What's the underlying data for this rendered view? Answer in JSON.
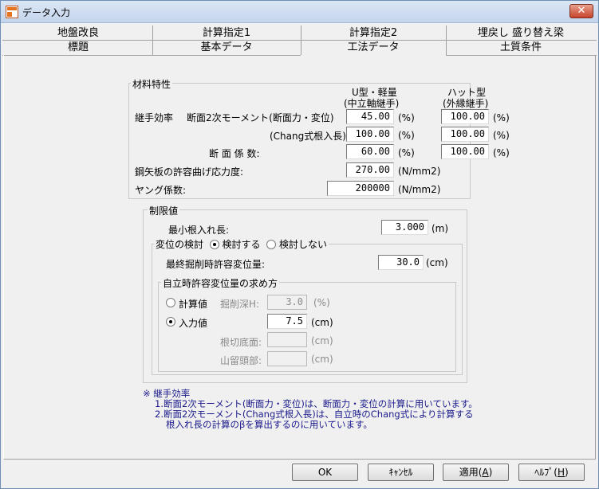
{
  "window": {
    "title": "データ入力",
    "close_label": "✕"
  },
  "tabs_row1": [
    "地盤改良",
    "計算指定1",
    "計算指定2",
    "埋戻し 盛り替え梁"
  ],
  "tabs_row2": [
    "標題",
    "基本データ",
    "工法データ",
    "土質条件"
  ],
  "material": {
    "group_title": "材料特性",
    "col1_header_line1": "U型・軽量",
    "col1_header_line2": "(中立軸継手)",
    "col2_header_line1": "ハット型",
    "col2_header_line2": "(外縁継手)",
    "joint_efficiency_label": "継手効率",
    "moment_label": "断面2次モーメント(断面力・変位)",
    "chang_label": "(Chang式根入長)",
    "section_modulus_label": "断 面 係 数:",
    "allowable_stress_label": "鋼矢板の許容曲げ応力度:",
    "young_label": "ヤング係数:",
    "moment_u": "45.00",
    "moment_hat": "100.00",
    "chang_u": "100.00",
    "chang_hat": "100.00",
    "modulus_u": "60.00",
    "modulus_hat": "100.00",
    "allowable_stress": "270.00",
    "young": "200000",
    "unit_pct": "(%)",
    "unit_stress": "(N/mm2)"
  },
  "limits": {
    "group_title": "制限値",
    "min_embed_label": "最小根入れ長:",
    "min_embed_value": "3.000",
    "unit_m": "(m)",
    "disp_check_title": "変位の検討",
    "disp_check_on": "検討する",
    "disp_check_off": "検討しない",
    "final_disp_label": "最終掘削時許容変位量:",
    "final_disp_value": "30.0",
    "unit_cm": "(cm)",
    "free_group_title": "自立時許容変位量の求め方",
    "calc_label": "計算値",
    "dig_depth_label": "掘削深H:",
    "dig_depth_value": "3.0",
    "unit_pct": "(%)",
    "input_label": "入力値",
    "input_value": "7.5",
    "root_bottom_label": "根切底面:",
    "pile_top_label": "山留頭部:",
    "root_bottom_value": "",
    "pile_top_value": ""
  },
  "notes": {
    "line1": "※ 継手効率",
    "line2": "1.断面2次モーメント(断面力・変位)は、断面力・変位の計算に用いています。",
    "line3": "2.断面2次モーメント(Chang式根入長)は、自立時のChang式により計算する",
    "line4": "根入れ長の計算のβを算出するのに用いています。"
  },
  "buttons": {
    "ok": "OK",
    "cancel": "ｷｬﾝｾﾙ",
    "apply": "適用",
    "apply_key": "A",
    "help": "ﾍﾙﾌﾟ",
    "help_key": "H"
  }
}
